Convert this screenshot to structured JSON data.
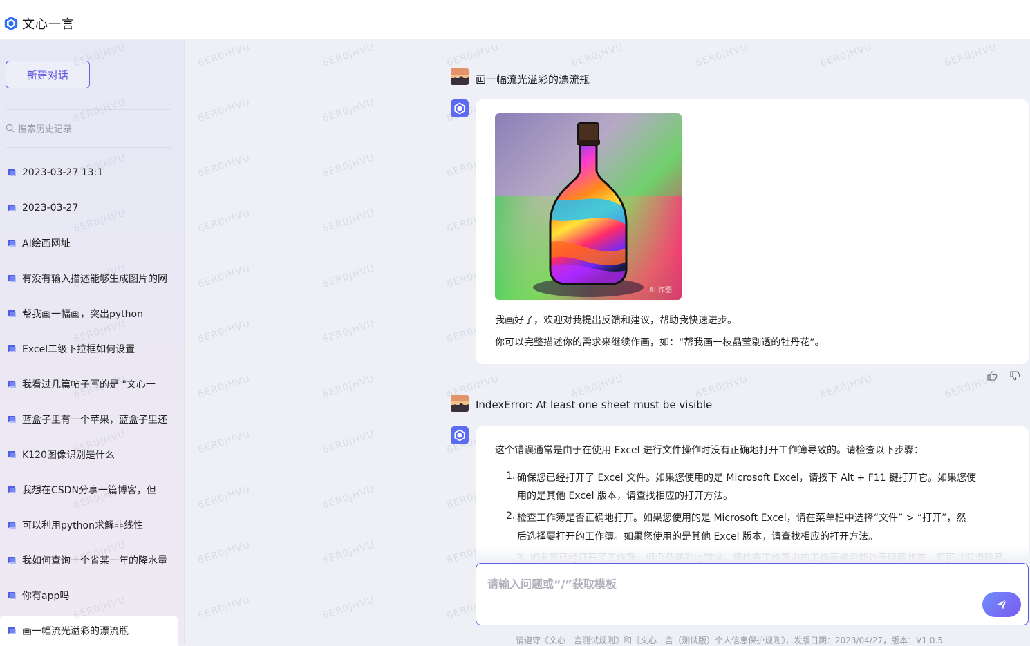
{
  "app": {
    "title": "文心一言"
  },
  "sidebar": {
    "new_chat_label": "新建对话",
    "search_placeholder": "搜索历史记录",
    "history": [
      {
        "label": "2023-03-27 13:1",
        "active": false
      },
      {
        "label": "2023-03-27",
        "active": false
      },
      {
        "label": "AI绘画网址",
        "active": false
      },
      {
        "label": "有没有输入描述能够生成图片的网",
        "active": false
      },
      {
        "label": "帮我画一幅画，突出python",
        "active": false
      },
      {
        "label": "Excel二级下拉框如何设置",
        "active": false
      },
      {
        "label": "我看过几篇帖子写的是 \"文心一",
        "active": false
      },
      {
        "label": "蓝盒子里有一个苹果，蓝盒子里还",
        "active": false
      },
      {
        "label": "K120图像识别是什么",
        "active": false
      },
      {
        "label": "我想在CSDN分享一篇博客，但",
        "active": false
      },
      {
        "label": "可以利用python求解非线性",
        "active": false
      },
      {
        "label": "我如何查询一个省某一年的降水量",
        "active": false
      },
      {
        "label": "你有app吗",
        "active": false
      },
      {
        "label": "画一幅流光溢彩的漂流瓶",
        "active": true
      }
    ]
  },
  "watermark": "6ER0jHVU",
  "conversation": {
    "q1": "画一幅流光溢彩的漂流瓶",
    "a1": {
      "image_tag": "AI 作图",
      "line1": "我画好了，欢迎对我提出反馈和建议，帮助我快速进步。",
      "line2": "你可以完整描述你的需求来继续作画，如：“帮我画一枝晶莹剔透的牡丹花”。"
    },
    "q2": "IndexError: At least one sheet must be visible",
    "a2": {
      "intro": "这个错误通常是由于在使用 Excel 进行文件操作时没有正确地打开工作簿导致的。请检查以下步骤：",
      "steps": [
        {
          "num": "1.",
          "line1": "确保您已经打开了 Excel 文件。如果您使用的是 Microsoft Excel，请按下 Alt + F11 键打开它。如果您使",
          "line2": "用的是其他 Excel 版本，请查找相应的打开方法。"
        },
        {
          "num": "2.",
          "line1": "检查工作簿是否正确地打开。如果您使用的是 Microsoft Excel，请在菜单栏中选择“文件” > “打开”，然",
          "line2": "后选择要打开的工作簿。如果您使用的是其他 Excel 版本，请查找相应的打开方法。"
        }
      ],
      "faded": "3. 如果您已经打开了工作簿，但仍然遇到此错误，请检查工作簿中的工作表是否都处于隐藏状态，您可以取消隐藏。"
    }
  },
  "input": {
    "placeholder": "请输入问题或“/”获取模板"
  },
  "footer": "请遵守《文心一言测试规则》和《文心一言（测试版）个人信息保护规则》，发版日期：2023/04/27，版本：V1.0.5",
  "colors": {
    "accent": "#5b55e6",
    "bot_avatar": "#5b6cf2"
  }
}
